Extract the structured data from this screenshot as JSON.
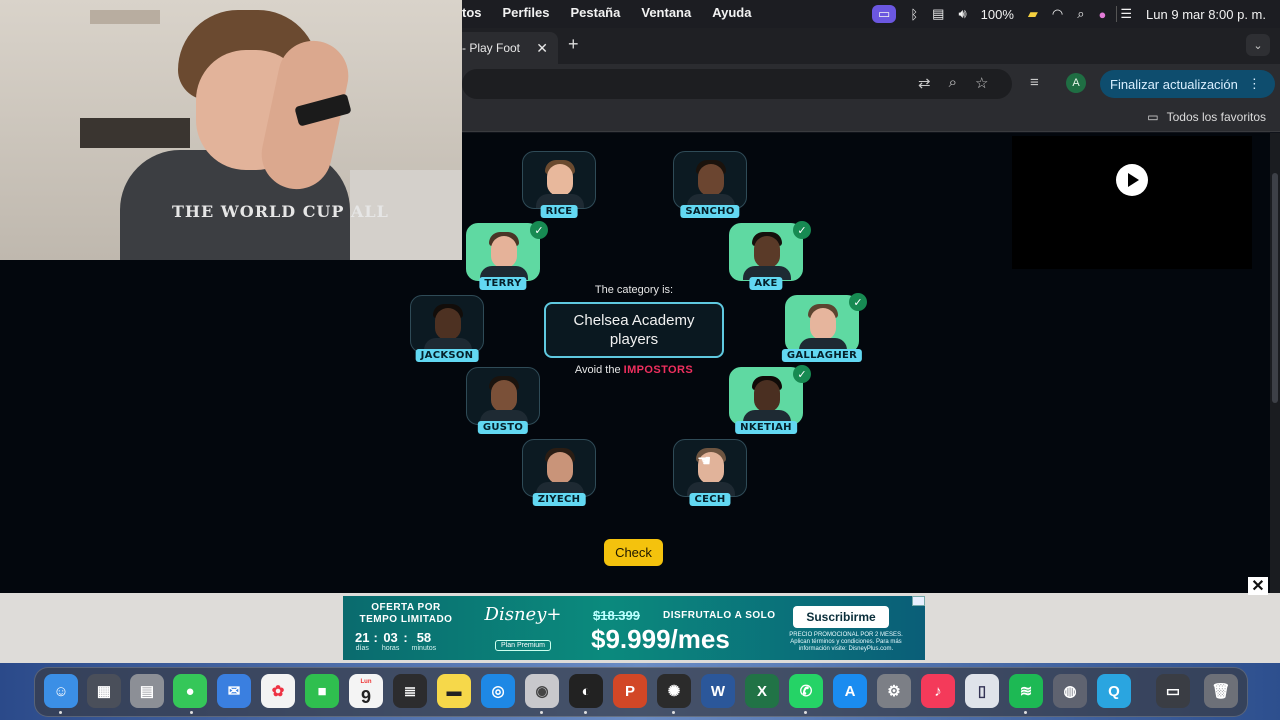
{
  "menubar": {
    "items": [
      "tos",
      "Perfiles",
      "Pestaña",
      "Ventana",
      "Ayuda"
    ],
    "battery": "100%",
    "datetime": "Lun 9 mar  8:00 p. m."
  },
  "browser": {
    "tab_title": "- Play Foot",
    "new_tab": "+",
    "update_button": "Finalizar actualización",
    "avatar_initial": "A",
    "bookmarks_folder": "Todos los favoritos"
  },
  "game": {
    "category_label": "The category is:",
    "category": "Chelsea Academy players",
    "avoid_prefix": "Avoid the",
    "avoid_highlight": "IMPOSTORS",
    "check_button": "Check",
    "players": [
      {
        "name": "RICE",
        "selected": false
      },
      {
        "name": "SANCHO",
        "selected": false
      },
      {
        "name": "TERRY",
        "selected": true
      },
      {
        "name": "AKE",
        "selected": true
      },
      {
        "name": "JACKSON",
        "selected": false
      },
      {
        "name": "GALLAGHER",
        "selected": true
      },
      {
        "name": "GUSTO",
        "selected": false
      },
      {
        "name": "NKETIAH",
        "selected": true
      },
      {
        "name": "ZIYECH",
        "selected": false
      },
      {
        "name": "CECH",
        "selected": false
      }
    ]
  },
  "webcam": {
    "shirt_text": "THE WORLD CUP ALL"
  },
  "ad": {
    "offer": "OFERTA POR TEMPO LIMITADO",
    "timer": {
      "days": "21",
      "hours": "03",
      "minutes": "58",
      "days_label": "días",
      "hours_label": "horas",
      "minutes_label": "minutos"
    },
    "brand": "Disney+",
    "plan": "Plan Premium",
    "old_price": "$18.399",
    "tagline": "DISFRUTALO A SOLO",
    "price": "$9.999/mes",
    "cta": "Suscribirme",
    "fine_print": "PRECIO PROMOCIONAL POR 2 MESES. Aplican términos y condiciones. Para más información visite: DisneyPlus.com.",
    "close": "✕"
  },
  "dock": {
    "calendar_month": "Lun",
    "calendar_day": "9"
  }
}
